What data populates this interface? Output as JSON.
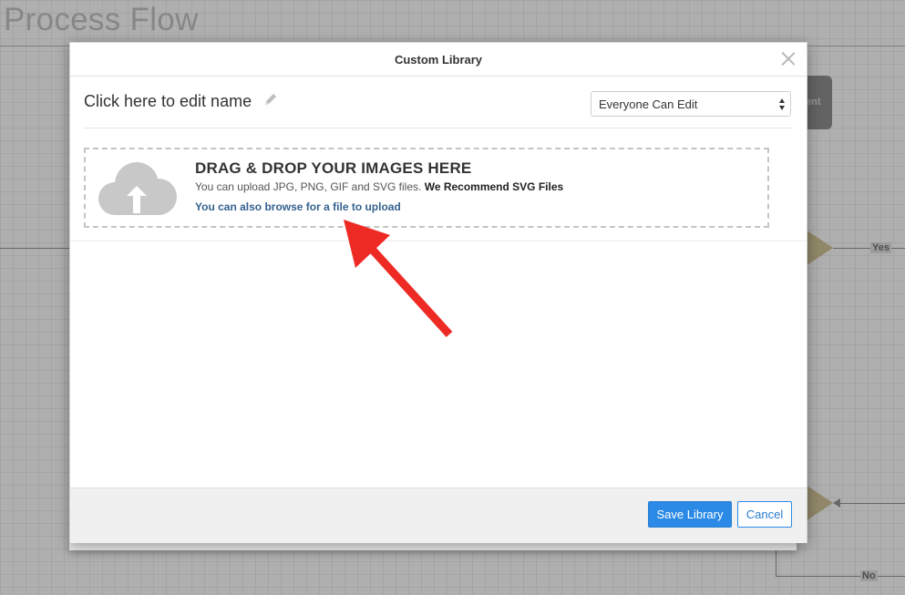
{
  "background": {
    "canvas_title": "Process Flow",
    "node_label": "ent",
    "yes_label": "Yes",
    "no_label": "No"
  },
  "modal": {
    "title": "Custom Library",
    "library_name": "Click here to edit name",
    "permission_select": {
      "selected": "Everyone Can Edit"
    },
    "dropzone": {
      "title": "DRAG & DROP YOUR IMAGES HERE",
      "description": "You can upload JPG, PNG, GIF and SVG files.",
      "recommendation": "We Recommend SVG Files",
      "browse_link": "You can also browse for a file to upload"
    },
    "footer": {
      "save_label": "Save Library",
      "cancel_label": "Cancel"
    }
  },
  "icons": [
    "close-icon",
    "pencil-icon",
    "cloud-upload-icon",
    "select-arrows-icon"
  ],
  "colors": {
    "primary": "#2b8ae6",
    "link": "#35628f",
    "annotation": "#ee2a24",
    "diamond": "#c9bd92"
  }
}
